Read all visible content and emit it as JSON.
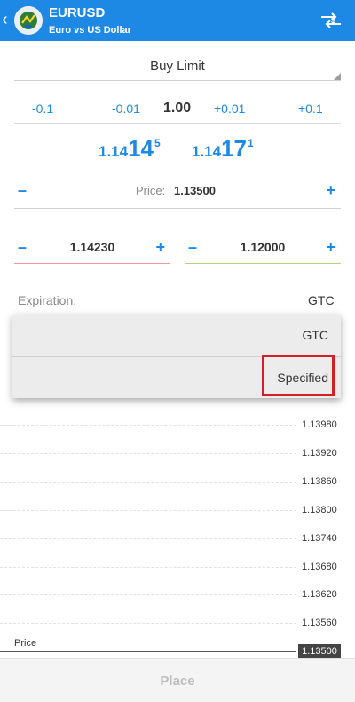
{
  "header": {
    "symbol": "EURUSD",
    "description": "Euro vs US Dollar",
    "color": "#1e88e5"
  },
  "order_type": {
    "value": "Buy Limit"
  },
  "volume": {
    "minus_0_1": "-0.1",
    "minus_0_01": "-0.01",
    "value": "1.00",
    "plus_0_01": "+0.01",
    "plus_0_1": "+0.1"
  },
  "quotes": {
    "bid": {
      "prefix": "1.14",
      "big": "14",
      "small": "5"
    },
    "ask": {
      "prefix": "1.14",
      "big": "17",
      "small": "1"
    }
  },
  "price_input": {
    "label": "Price:",
    "value": "1.13500",
    "minus": "–",
    "plus": "+"
  },
  "stop_loss": {
    "value": "1.14230",
    "minus": "–",
    "plus": "+"
  },
  "take_profit": {
    "value": "1.12000",
    "minus": "–",
    "plus": "+"
  },
  "expiration": {
    "label": "Expiration:",
    "value": "GTC",
    "options": [
      {
        "label": "GTC"
      },
      {
        "label": "Specified"
      }
    ]
  },
  "chart": {
    "ticks": [
      "1.13980",
      "1.13920",
      "1.13860",
      "1.13800",
      "1.13740",
      "1.13680",
      "1.13620",
      "1.13560"
    ],
    "price_caption": "Price",
    "price_tag": "1.13500"
  },
  "footer": {
    "place_label": "Place"
  },
  "colors": {
    "accent": "#1e88e5",
    "highlight": "#d32027",
    "sl": "#ef9a9a",
    "tp": "#aed581"
  }
}
